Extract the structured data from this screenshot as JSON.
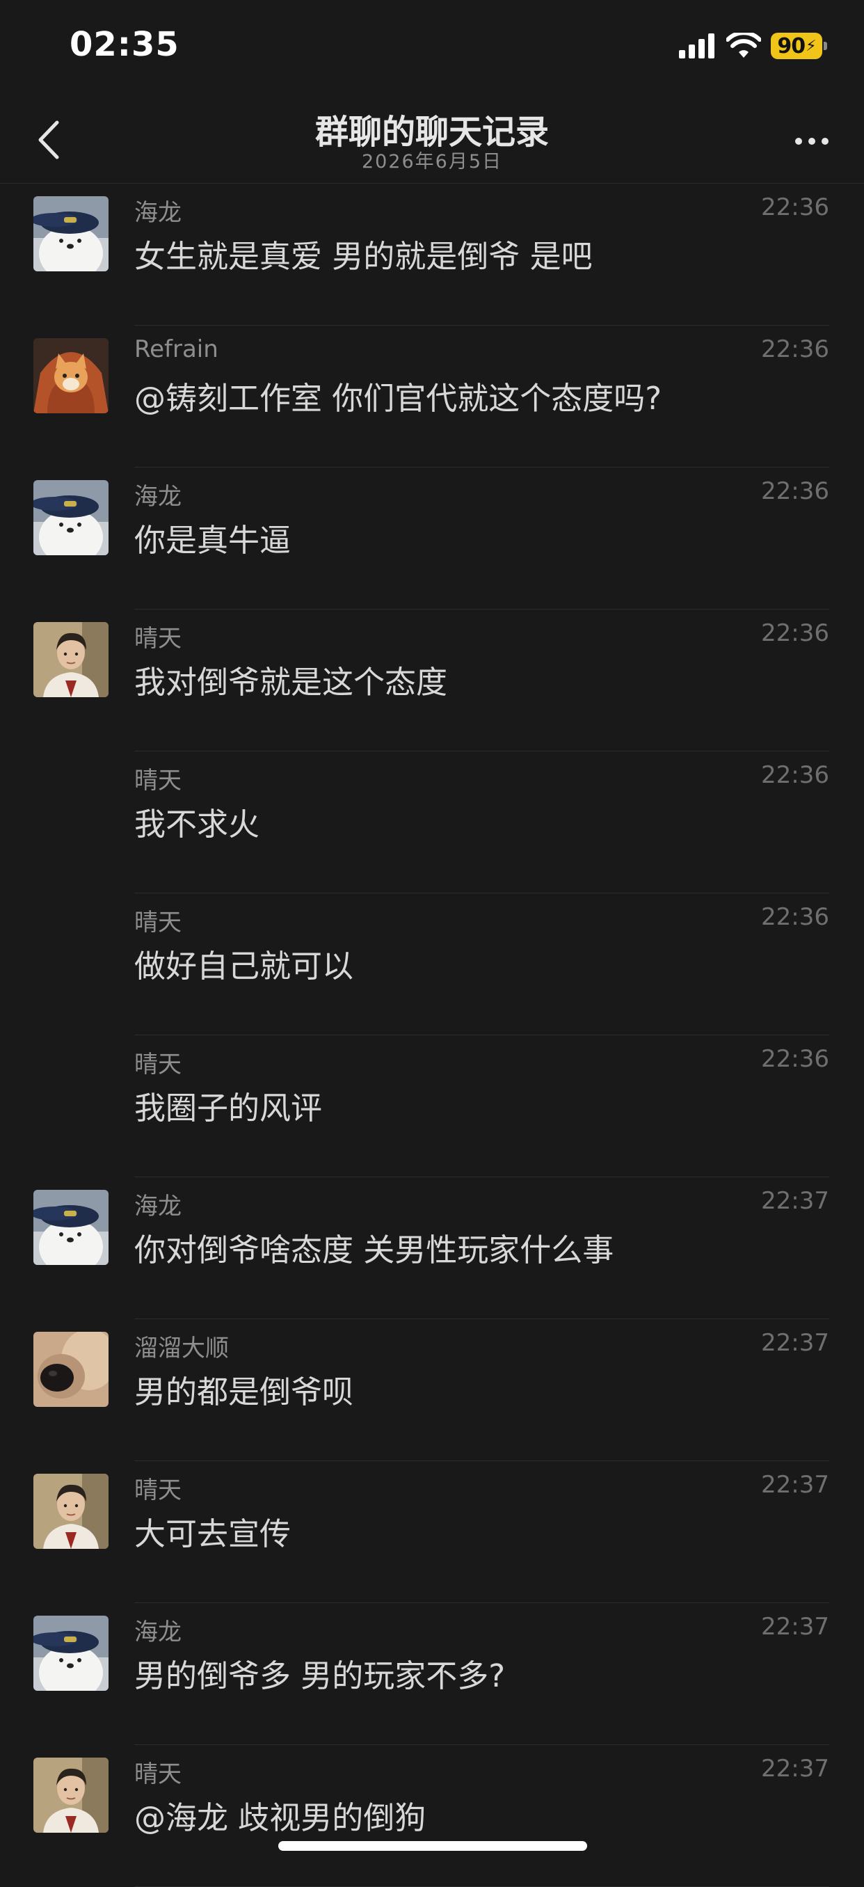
{
  "status_bar": {
    "time": "02:35",
    "battery": "90",
    "icons": [
      "signal-icon",
      "wifi-icon",
      "battery-icon"
    ]
  },
  "header": {
    "title": "群聊的聊天记录",
    "subtitle": "2026年6月5日",
    "back_icon": "chevron-left-icon",
    "more_icon": "more-dots-icon"
  },
  "colors": {
    "background": "#191919",
    "battery": "#f0c419",
    "text_primary": "#d8d8d8",
    "text_secondary": "#8e8e8e"
  },
  "messages": [
    {
      "sender": "海龙",
      "time": "22:36",
      "text": "女生就是真爱 男的就是倒爷 是吧",
      "avatar": "bear"
    },
    {
      "sender": "Refrain",
      "time": "22:36",
      "text": "@铸刻工作室 你们官代就这个态度吗?",
      "avatar": "cat"
    },
    {
      "sender": "海龙",
      "time": "22:36",
      "text": "你是真牛逼",
      "avatar": "bear"
    },
    {
      "sender": "晴天",
      "time": "22:36",
      "text": "我对倒爷就是这个态度",
      "avatar": "person"
    },
    {
      "sender": "晴天",
      "time": "22:36",
      "text": "我不求火",
      "avatar": ""
    },
    {
      "sender": "晴天",
      "time": "22:36",
      "text": "做好自己就可以",
      "avatar": ""
    },
    {
      "sender": "晴天",
      "time": "22:36",
      "text": "我圈子的风评",
      "avatar": ""
    },
    {
      "sender": "海龙",
      "time": "22:37",
      "text": "你对倒爷啥态度 关男性玩家什么事",
      "avatar": "bear"
    },
    {
      "sender": "溜溜大顺",
      "time": "22:37",
      "text": "男的都是倒爷呗",
      "avatar": "dog"
    },
    {
      "sender": "晴天",
      "time": "22:37",
      "text": "大可去宣传",
      "avatar": "person"
    },
    {
      "sender": "海龙",
      "time": "22:37",
      "text": "男的倒爷多 男的玩家不多?",
      "avatar": "bear"
    },
    {
      "sender": "晴天",
      "time": "22:37",
      "text": "@海龙 歧视男的倒狗",
      "avatar": "person"
    }
  ]
}
